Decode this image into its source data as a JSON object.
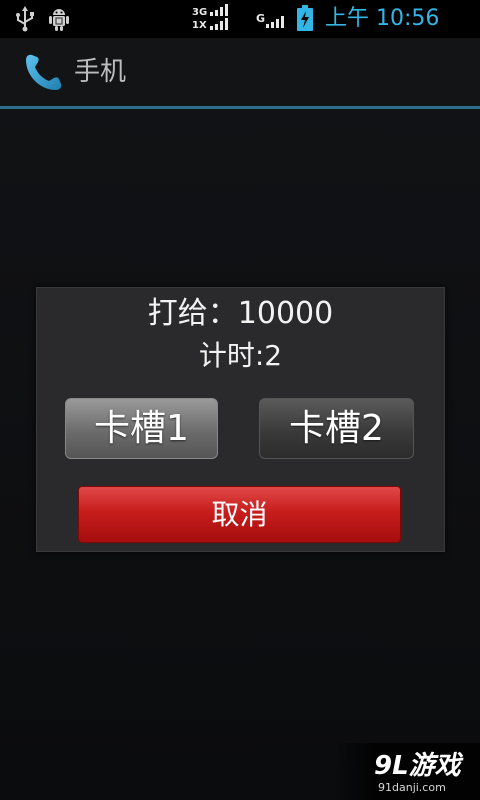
{
  "status_bar": {
    "icons": [
      "usb-icon",
      "android-debug-icon",
      "signal-icon",
      "battery-charging-icon"
    ],
    "network_top": "3G",
    "network_bottom": "1X",
    "network_second": "G",
    "time": "上午 10:56",
    "time_color": "#33b5e5"
  },
  "title_bar": {
    "icon": "phone-icon",
    "title": "手机",
    "divider_color": "#2c6e8a"
  },
  "dialog": {
    "dial_target": "打给：10000",
    "timer": "计时:2",
    "sim1_label": "卡槽1",
    "sim2_label": "卡槽2",
    "cancel_label": "取消",
    "cancel_color": "#c81d1d"
  },
  "watermark": {
    "logo": "9L游戏",
    "url": "91danji.com"
  }
}
